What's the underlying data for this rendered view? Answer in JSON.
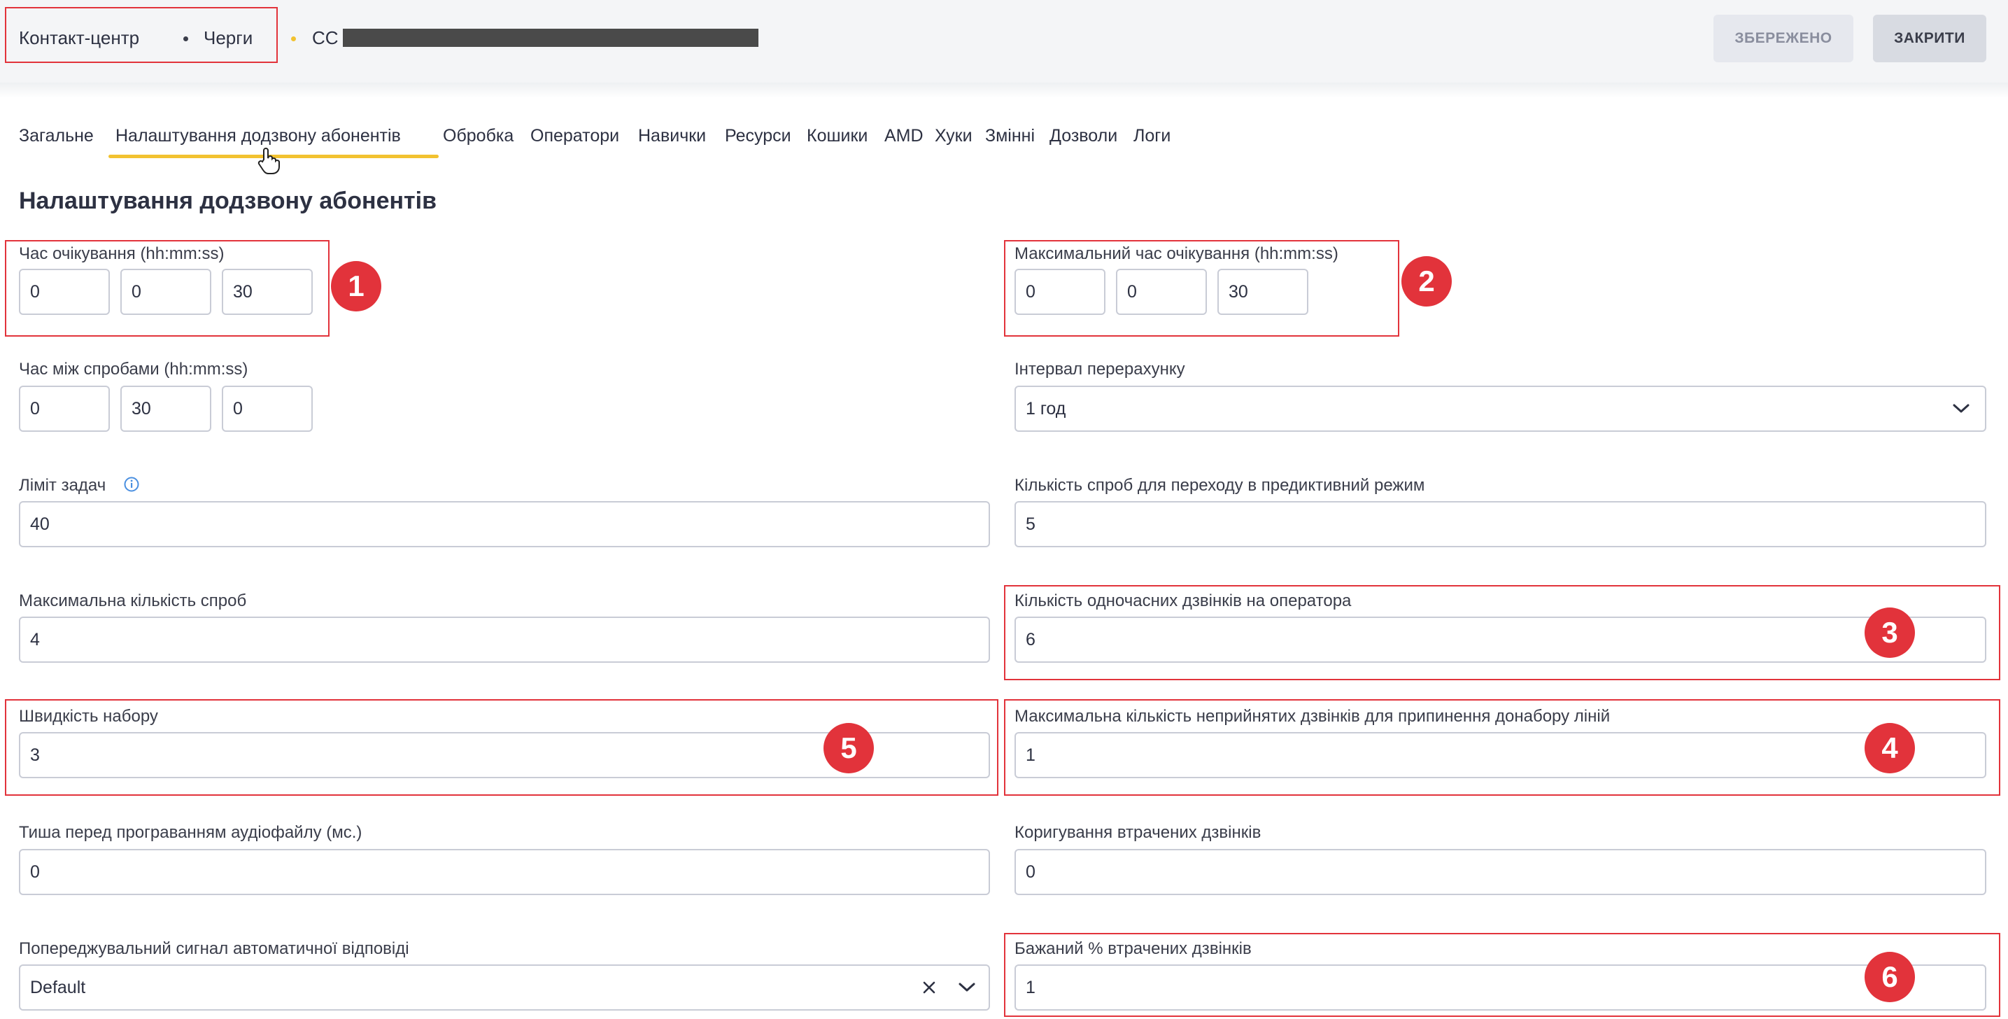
{
  "breadcrumb": {
    "items": [
      "Контакт-центр",
      "Черги"
    ],
    "current": "СС"
  },
  "actions": {
    "saved_label": "ЗБЕРЕЖЕНО",
    "close_label": "ЗАКРИТИ"
  },
  "tabs": [
    {
      "label": "Загальне"
    },
    {
      "label": "Налаштування додзвону абонентів",
      "active": true
    },
    {
      "label": "Обробка"
    },
    {
      "label": "Оператори"
    },
    {
      "label": "Навички"
    },
    {
      "label": "Ресурси"
    },
    {
      "label": "Кошики"
    },
    {
      "label": "AMD"
    },
    {
      "label": "Хуки"
    },
    {
      "label": "Змінні"
    },
    {
      "label": "Дозволи"
    },
    {
      "label": "Логи"
    }
  ],
  "page_title": "Налаштування додзвону абонентів",
  "fields": {
    "wait_time": {
      "label": "Час очікування (hh:mm:ss)",
      "h": "0",
      "m": "0",
      "s": "30"
    },
    "max_wait_time": {
      "label": "Максимальний час очікування (hh:mm:ss)",
      "h": "0",
      "m": "0",
      "s": "30"
    },
    "retry_interval": {
      "label": "Час між спробами (hh:mm:ss)",
      "h": "0",
      "m": "30",
      "s": "0"
    },
    "recalc_interval": {
      "label": "Інтервал перерахунку",
      "value": "1 год"
    },
    "task_limit": {
      "label": "Ліміт задач",
      "value": "40"
    },
    "predictive_attempts": {
      "label": "Кількість спроб для переходу в предиктивний режим",
      "value": "5"
    },
    "max_attempts": {
      "label": "Максимальна кількість спроб",
      "value": "4"
    },
    "concurrent_calls": {
      "label": "Кількість одночасних дзвінків на оператора",
      "value": "6"
    },
    "dial_speed": {
      "label": "Швидкість набору",
      "value": "3"
    },
    "max_unanswered": {
      "label": "Максимальна кількість неприйнятих дзвінків для припинення донабору ліній",
      "value": "1"
    },
    "silence_before_audio": {
      "label": "Тиша перед програванням аудіофайлу (мс.)",
      "value": "0"
    },
    "lost_calls_correction": {
      "label": "Коригування втрачених дзвінків",
      "value": "0"
    },
    "answer_warning_signal": {
      "label": "Попереджувальний сигнал автоматичної відповіді",
      "value": "Default"
    },
    "desired_lost_percent": {
      "label": "Бажаний % втрачених дзвінків",
      "value": "1"
    }
  },
  "annotations": [
    "1",
    "2",
    "3",
    "4",
    "5",
    "6"
  ],
  "colors": {
    "accent": "#f2c230",
    "annotation_red": "#e2333b",
    "border": "#c9ccd6",
    "text": "#2d3142"
  },
  "icons": [
    "info-icon",
    "chevron-down-icon",
    "clear-x-icon",
    "hand-pointer-icon"
  ]
}
